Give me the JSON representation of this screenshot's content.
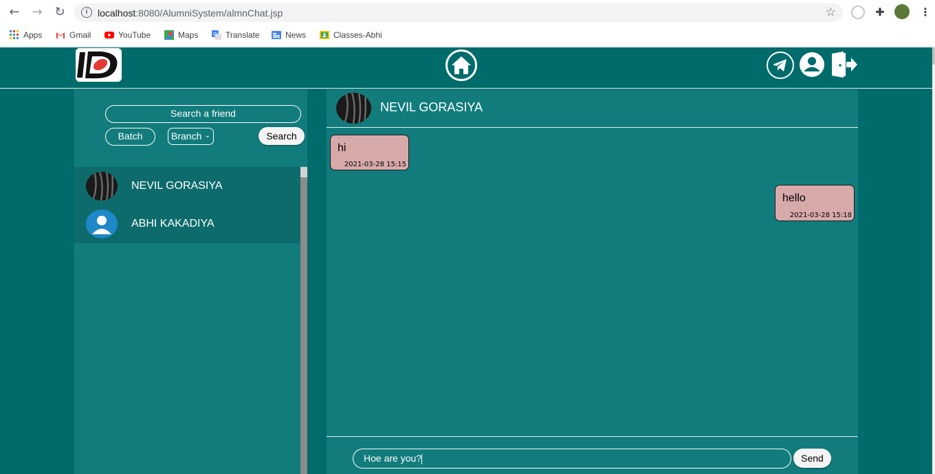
{
  "browser": {
    "url_host": "localhost",
    "url_rest": ":8080/AlumniSystem/almnChat.jsp",
    "bookmarks": [
      {
        "label": "Apps",
        "icon": "apps-grid-icon"
      },
      {
        "label": "Gmail",
        "icon": "gmail-icon"
      },
      {
        "label": "YouTube",
        "icon": "youtube-icon"
      },
      {
        "label": "Maps",
        "icon": "maps-icon"
      },
      {
        "label": "Translate",
        "icon": "translate-icon"
      },
      {
        "label": "News",
        "icon": "news-icon"
      },
      {
        "label": "Classes-Abhi",
        "icon": "classroom-icon"
      }
    ]
  },
  "colors": {
    "page_bg": "#006b6b",
    "panel_bg": "#127c7c",
    "bubble_bg": "#d8a9a9"
  },
  "header": {
    "home_icon": "home-icon",
    "telegram_icon": "telegram-icon",
    "profile_icon": "user-icon",
    "logout_icon": "logout-icon"
  },
  "sidebar": {
    "search_label": "Search a friend",
    "batch_label": "Batch",
    "branch_label": "Branch",
    "search_button": "Search",
    "friends": [
      {
        "name": "NEVIL GORASIYA",
        "active": true
      },
      {
        "name": "ABHI KAKADIYA",
        "active": false
      }
    ]
  },
  "chat": {
    "contact_name": "NEVIL GORASIYA",
    "messages": [
      {
        "direction": "incoming",
        "text": "hi",
        "time": "2021-03-28 15:15"
      },
      {
        "direction": "outgoing",
        "text": "hello",
        "time": "2021-03-28 15:18"
      }
    ],
    "input_value": "Hoe are you?",
    "send_label": "Send"
  }
}
